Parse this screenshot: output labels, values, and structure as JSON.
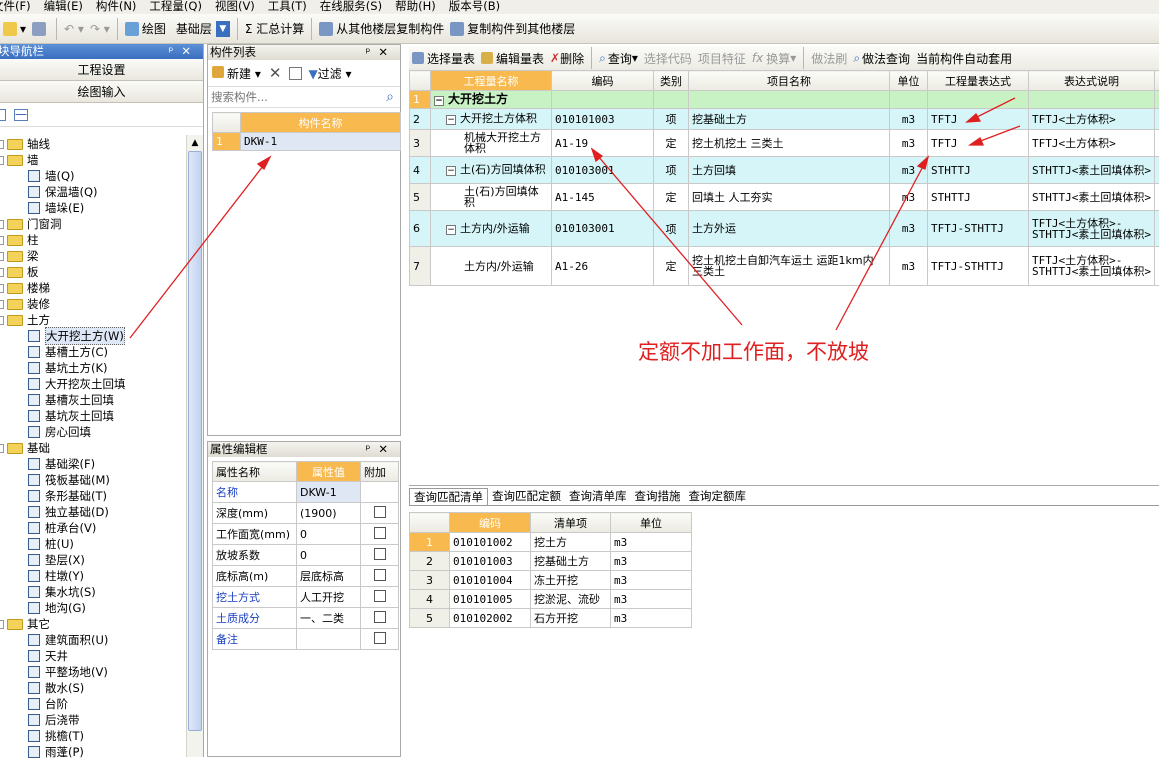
{
  "menu": [
    "文件(F)",
    "编辑(E)",
    "构件(N)",
    "工程量(Q)",
    "视图(V)",
    "工具(T)",
    "在线服务(S)",
    "帮助(H)",
    "版本号(B)"
  ],
  "toolbar": {
    "draw": "绘图",
    "layer": "基础层",
    "sum": "Σ 汇总计算",
    "copy_from": "从其他楼层复制构件",
    "copy_to": "复制构件到其他楼层"
  },
  "nav": {
    "title": "块导航栏",
    "btn1": "工程设置",
    "btn2": "绘图输入",
    "items": [
      {
        "label": "轴线",
        "level": 0,
        "type": "folder"
      },
      {
        "label": "墙",
        "level": 0,
        "type": "folder"
      },
      {
        "label": "墙(Q)",
        "level": 1,
        "type": "item"
      },
      {
        "label": "保温墙(Q)",
        "level": 1,
        "type": "item"
      },
      {
        "label": "墙垛(E)",
        "level": 1,
        "type": "item"
      },
      {
        "label": "门窗洞",
        "level": 0,
        "type": "folder"
      },
      {
        "label": "柱",
        "level": 0,
        "type": "folder"
      },
      {
        "label": "梁",
        "level": 0,
        "type": "folder"
      },
      {
        "label": "板",
        "level": 0,
        "type": "folder"
      },
      {
        "label": "楼梯",
        "level": 0,
        "type": "folder"
      },
      {
        "label": "装修",
        "level": 0,
        "type": "folder"
      },
      {
        "label": "土方",
        "level": 0,
        "type": "folder"
      },
      {
        "label": "大开挖土方(W)",
        "level": 1,
        "type": "item",
        "selected": true
      },
      {
        "label": "基槽土方(C)",
        "level": 1,
        "type": "item"
      },
      {
        "label": "基坑土方(K)",
        "level": 1,
        "type": "item"
      },
      {
        "label": "大开挖灰土回填",
        "level": 1,
        "type": "item"
      },
      {
        "label": "基槽灰土回填",
        "level": 1,
        "type": "item"
      },
      {
        "label": "基坑灰土回填",
        "level": 1,
        "type": "item"
      },
      {
        "label": "房心回填",
        "level": 1,
        "type": "item"
      },
      {
        "label": "基础",
        "level": 0,
        "type": "folder"
      },
      {
        "label": "基础梁(F)",
        "level": 1,
        "type": "item"
      },
      {
        "label": "筏板基础(M)",
        "level": 1,
        "type": "item"
      },
      {
        "label": "条形基础(T)",
        "level": 1,
        "type": "item"
      },
      {
        "label": "独立基础(D)",
        "level": 1,
        "type": "item"
      },
      {
        "label": "桩承台(V)",
        "level": 1,
        "type": "item"
      },
      {
        "label": "桩(U)",
        "level": 1,
        "type": "item"
      },
      {
        "label": "垫层(X)",
        "level": 1,
        "type": "item"
      },
      {
        "label": "柱墩(Y)",
        "level": 1,
        "type": "item"
      },
      {
        "label": "集水坑(S)",
        "level": 1,
        "type": "item"
      },
      {
        "label": "地沟(G)",
        "level": 1,
        "type": "item"
      },
      {
        "label": "其它",
        "level": 0,
        "type": "folder"
      },
      {
        "label": "建筑面积(U)",
        "level": 1,
        "type": "item"
      },
      {
        "label": "天井",
        "level": 1,
        "type": "item"
      },
      {
        "label": "平整场地(V)",
        "level": 1,
        "type": "item"
      },
      {
        "label": "散水(S)",
        "level": 1,
        "type": "item"
      },
      {
        "label": "台阶",
        "level": 1,
        "type": "item"
      },
      {
        "label": "后浇带",
        "level": 1,
        "type": "item"
      },
      {
        "label": "挑檐(T)",
        "level": 1,
        "type": "item"
      },
      {
        "label": "雨蓬(P)",
        "level": 1,
        "type": "item"
      }
    ]
  },
  "comp": {
    "title": "构件列表",
    "new": "新建",
    "filter": "过滤",
    "search_placeholder": "搜索构件...",
    "col": "构件名称",
    "rows": [
      {
        "n": "1",
        "name": "DKW-1"
      }
    ]
  },
  "props": {
    "title": "属性编辑框",
    "h1": "属性名称",
    "h2": "属性值",
    "h3": "附加",
    "rows": [
      {
        "name": "名称",
        "val": "DKW-1",
        "blue": true,
        "cb": false
      },
      {
        "name": "深度(mm)",
        "val": "(1900)",
        "blue": false,
        "cb": true
      },
      {
        "name": "工作面宽(mm)",
        "val": "0",
        "blue": false,
        "cb": true
      },
      {
        "name": "放坡系数",
        "val": "0",
        "blue": false,
        "cb": true
      },
      {
        "name": "底标高(m)",
        "val": "层底标高",
        "blue": false,
        "cb": true
      },
      {
        "name": "挖土方式",
        "val": "人工开挖",
        "blue": true,
        "cb": true
      },
      {
        "name": "土质成分",
        "val": "一、二类",
        "blue": true,
        "cb": true
      },
      {
        "name": "备注",
        "val": "",
        "blue": true,
        "cb": true
      }
    ]
  },
  "qtb": {
    "select": "选择量表",
    "edit": "编辑量表",
    "del": "删除",
    "query": "查询",
    "sel_code": "选择代码",
    "feature": "项目特征",
    "convert": "换算",
    "brush": "做法刷",
    "method_query": "做法查询",
    "auto": "当前构件自动套用"
  },
  "qtable": {
    "headers": [
      "工程量名称",
      "编码",
      "类别",
      "项目名称",
      "单位",
      "工程量表达式",
      "表达式说明"
    ],
    "rows": [
      {
        "n": "1",
        "name": "大开挖土方",
        "code": "",
        "cat": "",
        "item": "",
        "unit": "",
        "expr": "",
        "desc": "",
        "style": "green",
        "indent": 0,
        "toggle": "−"
      },
      {
        "n": "2",
        "name": "大开挖土方体积",
        "code": "010101003",
        "cat": "项",
        "item": "挖基础土方",
        "unit": "m3",
        "expr": "TFTJ",
        "desc": "TFTJ<土方体积>",
        "style": "cyan",
        "indent": 1,
        "toggle": "−"
      },
      {
        "n": "3",
        "name": "机械大开挖土方体积",
        "code": "A1-19",
        "cat": "定",
        "item": "挖土机挖土 三类土",
        "unit": "m3",
        "expr": "TFTJ",
        "desc": "TFTJ<土方体积>",
        "style": "white",
        "indent": 2,
        "toggle": ""
      },
      {
        "n": "4",
        "name": "土(石)方回填体积",
        "code": "010103001",
        "cat": "项",
        "item": "土方回填",
        "unit": "m3",
        "expr": "STHTTJ",
        "desc": "STHTTJ<素土回填体积>",
        "style": "cyan",
        "indent": 1,
        "toggle": "−"
      },
      {
        "n": "5",
        "name": "土(石)方回填体积",
        "code": "A1-145",
        "cat": "定",
        "item": "回填土 人工夯实",
        "unit": "m3",
        "expr": "STHTTJ",
        "desc": "STHTTJ<素土回填体积>",
        "style": "white",
        "indent": 2,
        "toggle": ""
      },
      {
        "n": "6",
        "name": "土方内/外运输",
        "code": "010103001",
        "cat": "项",
        "item": "土方外运",
        "unit": "m3",
        "expr": "TFTJ-STHTTJ",
        "desc": "TFTJ<土方体积>-STHTTJ<素土回填体积>",
        "style": "cyan",
        "indent": 1,
        "toggle": "−"
      },
      {
        "n": "7",
        "name": "土方内/外运输",
        "code": "A1-26",
        "cat": "定",
        "item": "挖土机挖土自卸汽车运土 运距1km内 三类土",
        "unit": "m3",
        "expr": "TFTJ-STHTTJ",
        "desc": "TFTJ<土方体积>-STHTTJ<素土回填体积>",
        "style": "white",
        "indent": 2,
        "toggle": ""
      }
    ]
  },
  "annotation": "定额不加工作面，不放坡",
  "query": {
    "tabs": [
      "查询匹配清单",
      "查询匹配定额",
      "查询清单库",
      "查询措施",
      "查询定额库"
    ],
    "headers": [
      "编码",
      "清单项",
      "单位"
    ],
    "rows": [
      {
        "n": "1",
        "code": "010101002",
        "item": "挖土方",
        "unit": "m3"
      },
      {
        "n": "2",
        "code": "010101003",
        "item": "挖基础土方",
        "unit": "m3"
      },
      {
        "n": "3",
        "code": "010101004",
        "item": "冻土开挖",
        "unit": "m3"
      },
      {
        "n": "4",
        "code": "010101005",
        "item": "挖淤泥、流砂",
        "unit": "m3"
      },
      {
        "n": "5",
        "code": "010102002",
        "item": "石方开挖",
        "unit": "m3"
      }
    ]
  }
}
